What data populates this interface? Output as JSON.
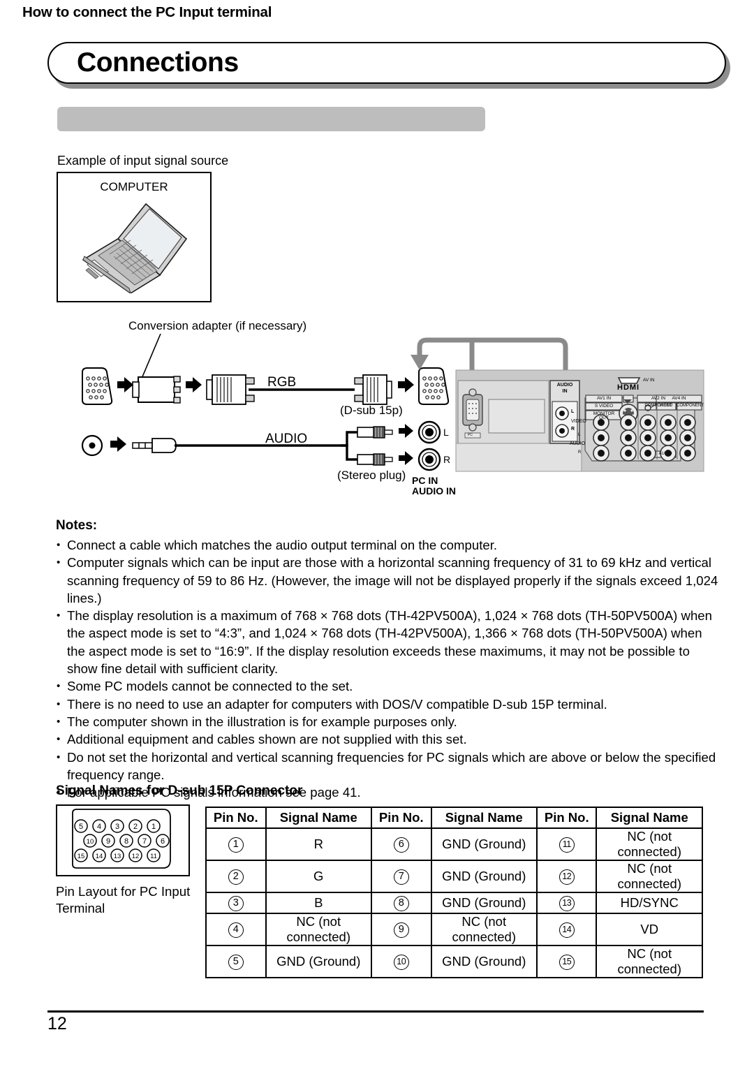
{
  "page": {
    "title": "Connections",
    "section_heading": "How to connect the PC Input terminal",
    "example_caption": "Example of input signal source",
    "page_number": "12"
  },
  "diagram": {
    "computer_box_label": "COMPUTER",
    "conversion_adapter_label": "Conversion adapter (if necessary)",
    "rgb_label": "RGB",
    "dsub_label": "(D-sub 15p)",
    "audio_label": "AUDIO",
    "stereo_plug_label": "(Stereo plug)",
    "jack_l": "L",
    "jack_r": "R",
    "pc_in_line1": "PC IN",
    "pc_in_line2": "AUDIO IN",
    "tv_panel": {
      "pc_port_label": "PC",
      "audio_in_line1": "AUDIO",
      "audio_in_line2": "IN",
      "audio_l": "L",
      "audio_r": "R",
      "hdmi_label": "HDMI",
      "hdmi_av_in": "AV IN",
      "av1_in": "AV1 IN",
      "s_video": "S VIDEO",
      "monitor_out_line1": "MONITOR",
      "monitor_out_line2": "OUT",
      "av2_in": "AV2 IN",
      "av4_in": "AV4 IN",
      "component": "COMPONENT",
      "video": "VIDEO",
      "audio": "AUDIO",
      "audio_l_small": "L",
      "audio_r_small": "R"
    }
  },
  "notes": {
    "heading": "Notes:",
    "items": [
      "Connect a cable which matches the audio output terminal on the computer.",
      "Computer signals which can be input are those with a horizontal scanning frequency of 31 to 69 kHz and vertical scanning frequency of 59 to 86 Hz. (However, the image will not be displayed properly if the signals exceed 1,024 lines.)",
      "The display resolution is a maximum of 768 × 768 dots (TH-42PV500A), 1,024 × 768 dots (TH-50PV500A) when the aspect mode is set to “4:3”, and 1,024 × 768 dots (TH-42PV500A), 1,366 × 768 dots (TH-50PV500A) when the aspect mode is set to “16:9”. If the display resolution exceeds these maximums, it may not be possible to show fine detail with sufficient clarity.",
      "Some PC models cannot be connected to the set.",
      "There is no need to use an adapter for computers with DOS/V compatible D-sub 15P terminal.",
      "The computer shown in the illustration is for example purposes only.",
      "Additional equipment and cables shown are not supplied with this set.",
      "Do not set the horizontal and vertical scanning frequencies for PC signals which are above or below the specified frequency range.",
      "For applicable PC signals information see page 41."
    ]
  },
  "signal_section": {
    "heading": "Signal Names for D-sub 15P Connector",
    "pin_layout_caption": "Pin Layout for PC Input Terminal",
    "pin_layout_rows": [
      [
        "5",
        "4",
        "3",
        "2",
        "1"
      ],
      [
        "10",
        "9",
        "8",
        "7",
        "6"
      ],
      [
        "15",
        "14",
        "13",
        "12",
        "11"
      ]
    ],
    "table": {
      "headers": [
        "Pin No.",
        "Signal Name",
        "Pin No.",
        "Signal Name",
        "Pin No.",
        "Signal Name"
      ],
      "rows": [
        [
          "1",
          "R",
          "6",
          "GND (Ground)",
          "11",
          "NC (not connected)"
        ],
        [
          "2",
          "G",
          "7",
          "GND (Ground)",
          "12",
          "NC (not connected)"
        ],
        [
          "3",
          "B",
          "8",
          "GND (Ground)",
          "13",
          "HD/SYNC"
        ],
        [
          "4",
          "NC (not connected)",
          "9",
          "NC (not connected)",
          "14",
          "VD"
        ],
        [
          "5",
          "GND (Ground)",
          "10",
          "GND (Ground)",
          "15",
          "NC (not connected)"
        ]
      ]
    }
  },
  "colors": {
    "banner_gray": "#bdbdbd",
    "shadow_gray": "#8e8e8e",
    "panel_gray": "#c9c9c9",
    "arrow_gray": "#8a8a8a"
  }
}
